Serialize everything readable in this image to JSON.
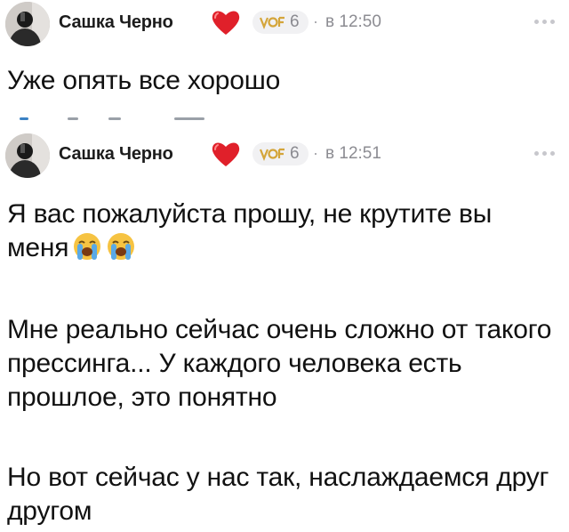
{
  "posts": [
    {
      "author": "Сашка Черно",
      "badge_count": "6",
      "time_sep": "·",
      "time": "в 12:50",
      "text": "Уже опять все хорошо"
    },
    {
      "author": "Сашка Черно",
      "badge_count": "6",
      "time_sep": "·",
      "time": "в 12:51",
      "paragraphs": [
        "Я вас пожалуйста прошу, не крутите вы меня",
        "Мне реально сейчас очень сложно от такого прессинга... У каждого человека есть прошлое, это понятно",
        "Но вот сейчас у нас так, наслаждаемся друг другом"
      ]
    }
  ],
  "icons": {
    "heart": "heart-icon",
    "badge": "level-badge-icon",
    "more": "more-dots-icon",
    "emoji": "loudly-crying-face-icon"
  },
  "colors": {
    "heart": "#e0202a",
    "badge_gold": "#d4a53a",
    "meta_gray": "#8c8c92"
  }
}
